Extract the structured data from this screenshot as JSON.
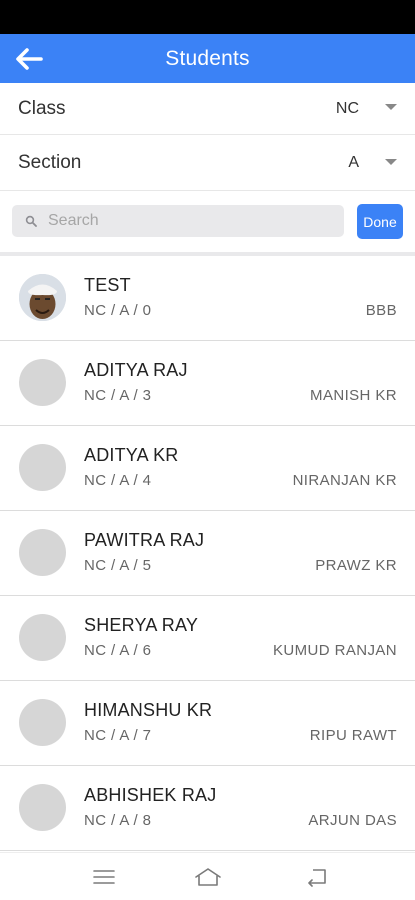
{
  "header": {
    "title": "Students",
    "back_icon": "arrow-left-icon"
  },
  "filters": {
    "class": {
      "label": "Class",
      "value": "NC"
    },
    "section": {
      "label": "Section",
      "value": "A"
    }
  },
  "search": {
    "placeholder": "Search",
    "value": "",
    "done_label": "Done"
  },
  "students": [
    {
      "name": "TEST",
      "meta": "NC / A / 0",
      "parent": "BBB",
      "has_photo": true
    },
    {
      "name": "ADITYA RAJ",
      "meta": "NC / A / 3",
      "parent": "MANISH KR",
      "has_photo": false
    },
    {
      "name": "ADITYA KR",
      "meta": "NC / A / 4",
      "parent": "NIRANJAN KR",
      "has_photo": false
    },
    {
      "name": "PAWITRA RAJ",
      "meta": "NC / A / 5",
      "parent": "PRAWZ KR",
      "has_photo": false
    },
    {
      "name": "SHERYA RAY",
      "meta": "NC / A / 6",
      "parent": "KUMUD RANJAN",
      "has_photo": false
    },
    {
      "name": "HIMANSHU KR",
      "meta": "NC / A / 7",
      "parent": "RIPU RAWT",
      "has_photo": false
    },
    {
      "name": "ABHISHEK RAJ",
      "meta": "NC / A / 8",
      "parent": "ARJUN DAS",
      "has_photo": false
    }
  ],
  "colors": {
    "accent": "#3b82f6",
    "avatar_placeholder": "#d6d6d6"
  },
  "nav": {
    "icons": [
      "menu-icon",
      "home-icon",
      "back-icon"
    ]
  }
}
